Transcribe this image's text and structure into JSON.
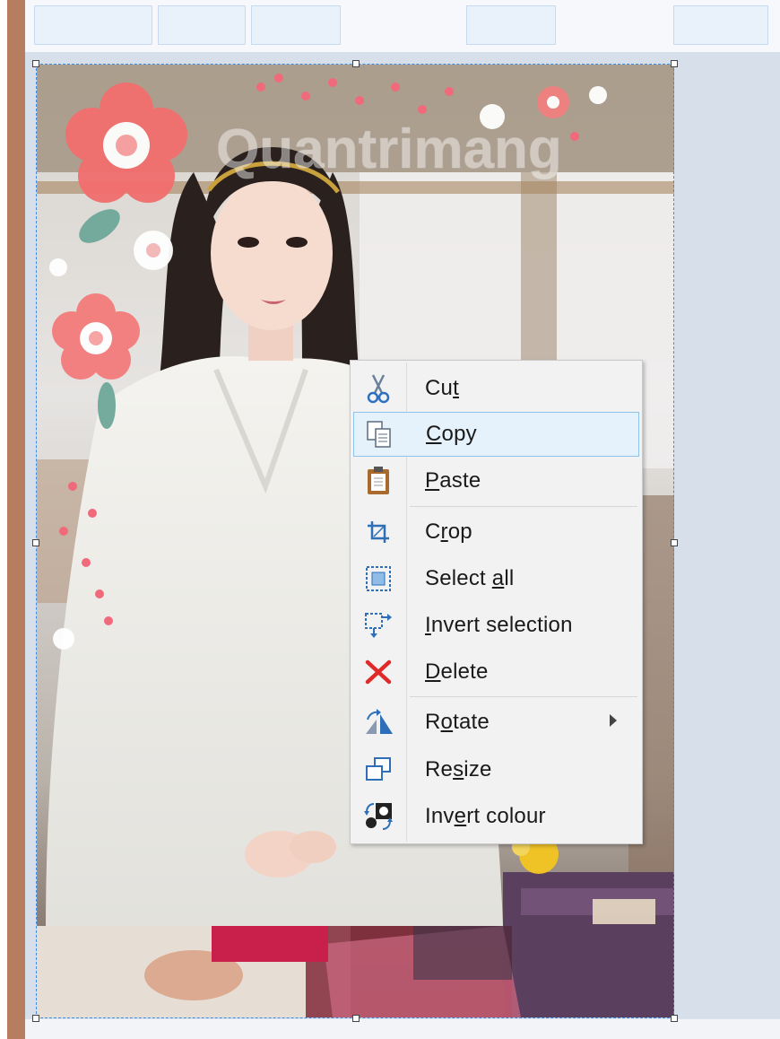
{
  "ribbon": {
    "slot_count": 5
  },
  "photo": {
    "watermark": "Quantrimang"
  },
  "context_menu": {
    "items": [
      {
        "label": "Cut",
        "access_key": "t",
        "icon": "scissors-icon"
      },
      {
        "label": "Copy",
        "access_key": "C",
        "icon": "copy-icon",
        "highlighted": true
      },
      {
        "label": "Paste",
        "access_key": "P",
        "icon": "clipboard-icon"
      },
      {
        "label": "Crop",
        "access_key": "r",
        "icon": "crop-icon"
      },
      {
        "label": "Select all",
        "access_key": "a",
        "icon": "select-all-icon"
      },
      {
        "label": "Invert selection",
        "access_key": "I",
        "icon": "invert-selection-icon"
      },
      {
        "label": "Delete",
        "access_key": "D",
        "icon": "delete-x-icon"
      },
      {
        "label": "Rotate",
        "access_key": "o",
        "icon": "rotate-icon",
        "has_submenu": true
      },
      {
        "label": "Resize",
        "access_key": "s",
        "icon": "resize-icon"
      },
      {
        "label": "Invert colour",
        "access_key": "e",
        "icon": "invert-colour-icon"
      }
    ]
  },
  "colors": {
    "selection_border": "#3d8be0",
    "menu_highlight": "#e5f1fb",
    "menu_highlight_border": "#8fc3ea"
  }
}
